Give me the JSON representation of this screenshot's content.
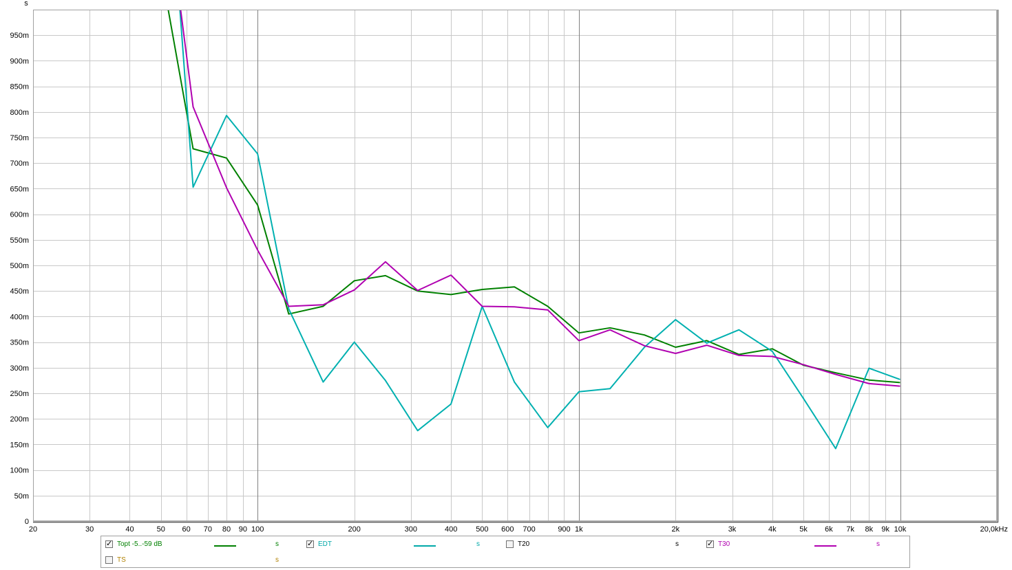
{
  "chart_data": {
    "type": "line",
    "xscale": "log",
    "xlim": [
      20,
      20000
    ],
    "ylim": [
      0,
      1.0
    ],
    "ylabel": "s",
    "grid": true,
    "x_ticks": [
      {
        "v": 20,
        "label": "20"
      },
      {
        "v": 30,
        "label": "30"
      },
      {
        "v": 40,
        "label": "40"
      },
      {
        "v": 50,
        "label": "50"
      },
      {
        "v": 60,
        "label": "60"
      },
      {
        "v": 70,
        "label": "70"
      },
      {
        "v": 80,
        "label": "80"
      },
      {
        "v": 90,
        "label": "90"
      },
      {
        "v": 100,
        "label": "100"
      },
      {
        "v": 200,
        "label": "200"
      },
      {
        "v": 300,
        "label": "300"
      },
      {
        "v": 400,
        "label": "400"
      },
      {
        "v": 500,
        "label": "500"
      },
      {
        "v": 600,
        "label": "600"
      },
      {
        "v": 700,
        "label": "700"
      },
      {
        "v": 900,
        "label": "900"
      },
      {
        "v": 1000,
        "label": "1k"
      },
      {
        "v": 2000,
        "label": "2k"
      },
      {
        "v": 3000,
        "label": "3k"
      },
      {
        "v": 4000,
        "label": "4k"
      },
      {
        "v": 5000,
        "label": "5k"
      },
      {
        "v": 6000,
        "label": "6k"
      },
      {
        "v": 7000,
        "label": "7k"
      },
      {
        "v": 8000,
        "label": "8k"
      },
      {
        "v": 9000,
        "label": "9k"
      },
      {
        "v": 10000,
        "label": "10k"
      },
      {
        "v": 20000,
        "label": "20,0kHz"
      }
    ],
    "x_minor_grid": [
      800,
      8000
    ],
    "x_major_grid": [
      100,
      1000,
      10000
    ],
    "y_ticks": [
      {
        "v": 0,
        "label": "0"
      },
      {
        "v": 0.05,
        "label": "50m"
      },
      {
        "v": 0.1,
        "label": "100m"
      },
      {
        "v": 0.15,
        "label": "150m"
      },
      {
        "v": 0.2,
        "label": "200m"
      },
      {
        "v": 0.25,
        "label": "250m"
      },
      {
        "v": 0.3,
        "label": "300m"
      },
      {
        "v": 0.35,
        "label": "350m"
      },
      {
        "v": 0.4,
        "label": "400m"
      },
      {
        "v": 0.45,
        "label": "450m"
      },
      {
        "v": 0.5,
        "label": "500m"
      },
      {
        "v": 0.55,
        "label": "550m"
      },
      {
        "v": 0.6,
        "label": "600m"
      },
      {
        "v": 0.65,
        "label": "650m"
      },
      {
        "v": 0.7,
        "label": "700m"
      },
      {
        "v": 0.75,
        "label": "750m"
      },
      {
        "v": 0.8,
        "label": "800m"
      },
      {
        "v": 0.85,
        "label": "850m"
      },
      {
        "v": 0.9,
        "label": "900m"
      },
      {
        "v": 0.95,
        "label": "950m"
      }
    ],
    "x": [
      50,
      63,
      80,
      100,
      125,
      160,
      200,
      250,
      315,
      400,
      500,
      630,
      800,
      1000,
      1250,
      1600,
      2000,
      2500,
      3150,
      4000,
      5000,
      6300,
      8000,
      10000
    ],
    "series": [
      {
        "name": "Topt -5..-59 dB",
        "color": "#008000",
        "values": [
          1.08,
          0.728,
          0.71,
          0.618,
          0.405,
          0.42,
          0.47,
          0.48,
          0.45,
          0.443,
          0.453,
          0.458,
          0.42,
          0.368,
          0.378,
          0.364,
          0.34,
          0.353,
          0.326,
          0.337,
          0.305,
          0.29,
          0.276,
          0.271
        ]
      },
      {
        "name": "EDT",
        "color": "#00b0b0",
        "values": [
          1.5,
          0.653,
          0.793,
          0.718,
          0.415,
          0.272,
          0.35,
          0.275,
          0.177,
          0.229,
          0.42,
          0.272,
          0.183,
          0.253,
          0.259,
          0.34,
          0.394,
          0.348,
          0.374,
          0.332,
          0.24,
          0.142,
          0.299,
          0.277
        ]
      },
      {
        "name": "T30",
        "color": "#b000b0",
        "values": [
          1.3,
          0.81,
          0.652,
          0.53,
          0.42,
          0.423,
          0.452,
          0.507,
          0.451,
          0.481,
          0.42,
          0.419,
          0.413,
          0.353,
          0.374,
          0.343,
          0.328,
          0.344,
          0.324,
          0.322,
          0.306,
          0.287,
          0.269,
          0.264
        ]
      }
    ]
  },
  "legend": {
    "items": [
      {
        "label": "Topt -5..-59 dB",
        "checked": true,
        "color": "#008000",
        "unit": "s"
      },
      {
        "label": "EDT",
        "checked": true,
        "color": "#00a8a8",
        "unit": "s"
      },
      {
        "label": "T20",
        "checked": false,
        "color": "#000000",
        "unit": "s"
      },
      {
        "label": "T30",
        "checked": true,
        "color": "#b000b0",
        "unit": "s"
      },
      {
        "label": "TS",
        "checked": false,
        "color": "#b08000",
        "unit": "s"
      }
    ]
  }
}
